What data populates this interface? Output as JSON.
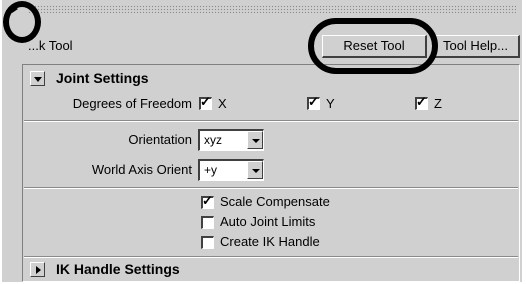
{
  "header": {
    "tool_title": "...k Tool",
    "reset_button": "Reset Tool",
    "help_button": "Tool Help..."
  },
  "joint_settings": {
    "title": "Joint Settings",
    "expanded": true,
    "dof": {
      "label": "Degrees of Freedom",
      "x": {
        "label": "X",
        "checked": true
      },
      "y": {
        "label": "Y",
        "checked": true
      },
      "z": {
        "label": "Z",
        "checked": true
      }
    },
    "orientation": {
      "label": "Orientation",
      "value": "xyz"
    },
    "world_axis": {
      "label": "World Axis Orient",
      "value": "+y"
    },
    "scale_compensate": {
      "label": "Scale Compensate",
      "checked": true
    },
    "auto_joint_limits": {
      "label": "Auto Joint Limits",
      "checked": false
    },
    "create_ik_handle": {
      "label": "Create IK Handle",
      "checked": false
    }
  },
  "ik_handle_settings": {
    "title": "IK Handle Settings",
    "expanded": false
  },
  "annotation_color": "#000000"
}
